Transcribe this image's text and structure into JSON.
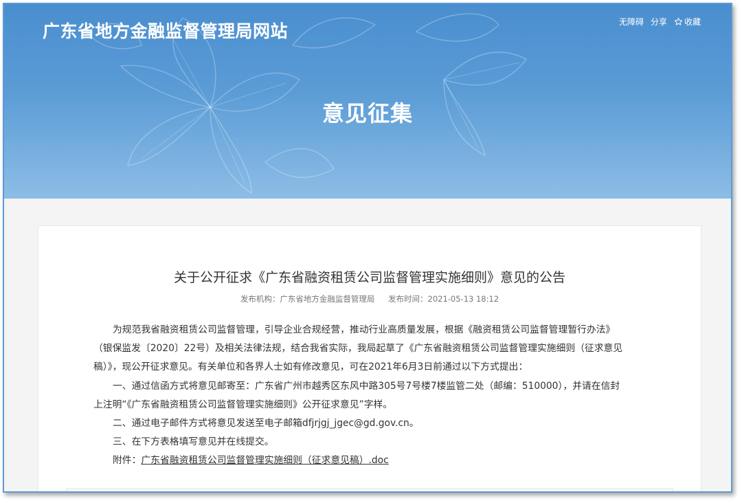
{
  "header": {
    "site_title": "广东省地方金融监督管理局网站",
    "links": {
      "accessibility": "无障碍",
      "share": "分享",
      "favorite": "收藏"
    },
    "banner_heading": "意见征集"
  },
  "article": {
    "title": "关于公开征求《广东省融资租赁公司监督管理实施细则》意见的公告",
    "meta": {
      "publisher": "发布机构：广东省地方金融监督管理局",
      "published_at": "发布时间：2021-05-13 18:12"
    },
    "paragraphs": {
      "intro_1": "为规范我省融资租赁公司监督管理，引导企业合规经营，推动行业高质量发展，根据《融资租赁公司监督管理暂行办法》",
      "intro_2": "（银保监发〔2020〕22号）及相关法律法规，结合我省实际，我局起草了《广东省融资租赁公司监督管理实施细则（征求意见",
      "intro_3": "稿）》，现公开征求意见。有关单位和各界人士如有修改意见，可在2021年6月3日前通过以下方式提出：",
      "item1_1": "一、通过信函方式将意见邮寄至：广东省广州市越秀区东风中路305号7号楼7楼监管二处（邮编：510000），并请在信封",
      "item1_2": "上注明“《广东省融资租赁公司监督管理实施细则》公开征求意见”字样。",
      "item2": "二、通过电子邮件方式将意见发送至电子邮箱dfjrjgj_jgec@gd.gov.cn。",
      "item3": "三、在下方表格填写意见并在线提交。",
      "attachment_label": "附件：",
      "attachment_link": "广东省融资租赁公司监督管理实施细则（征求意见稿）.doc"
    }
  },
  "colors": {
    "banner_top": "#4a8ecf",
    "banner_bottom": "#8dbde6",
    "frame_border": "#5b9bd5"
  },
  "icons": [
    "star-outline-icon"
  ]
}
